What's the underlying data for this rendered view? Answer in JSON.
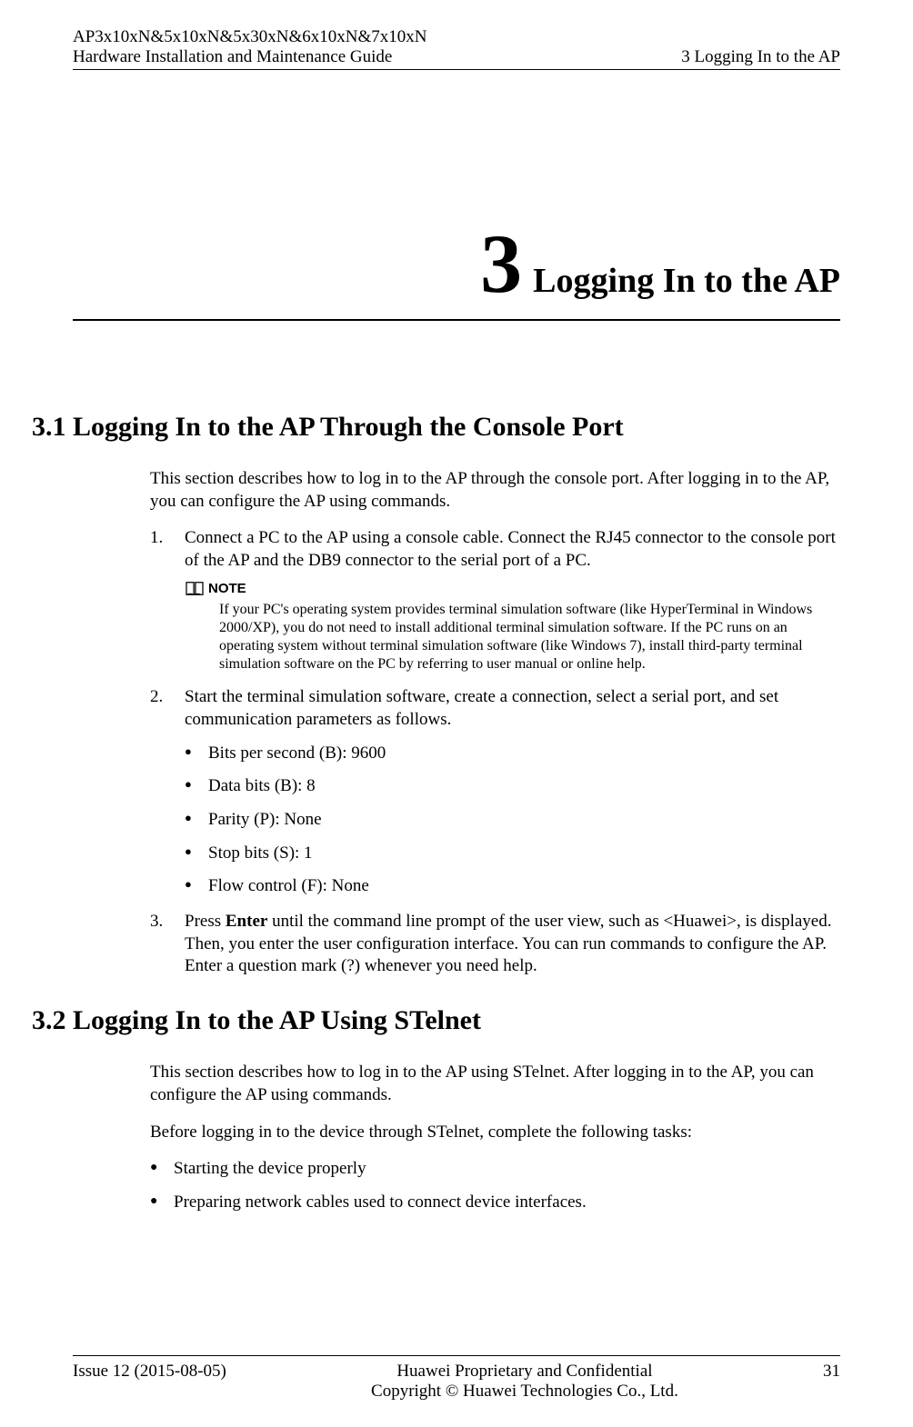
{
  "header": {
    "product_line1": "AP3x10xN&5x10xN&5x30xN&6x10xN&7x10xN",
    "product_line2": "Hardware Installation and Maintenance Guide",
    "right": "3 Logging In to the AP"
  },
  "chapter": {
    "number": "3",
    "title": "Logging In to the AP"
  },
  "section1": {
    "heading": "3.1 Logging In to the AP Through the Console Port",
    "intro": "This section describes how to log in to the AP through the console port. After logging in to the AP, you can configure the AP using commands.",
    "step1_num": "1.",
    "step1": "Connect a PC to the AP using a console cable. Connect the RJ45 connector to the console port of the AP and the DB9 connector to the serial port of a PC.",
    "note_label": "NOTE",
    "note_text": "If your PC's operating system provides terminal simulation software (like HyperTerminal in Windows 2000/XP), you do not need to install additional terminal simulation software. If the PC runs on an operating system without terminal simulation software (like Windows 7), install third-party terminal simulation software on the PC by referring to user manual or online help.",
    "step2_num": "2.",
    "step2": "Start the terminal simulation software, create a connection, select a serial port, and set communication parameters as follows.",
    "params": {
      "bits_per_second": "Bits per second (B): 9600",
      "data_bits": "Data bits (B): 8",
      "parity": "Parity (P): None",
      "stop_bits": "Stop bits (S): 1",
      "flow_control": "Flow control (F): None"
    },
    "step3_num": "3.",
    "step3_pre": "Press ",
    "step3_bold": "Enter",
    "step3_post": " until the command line prompt of the user view, such as <Huawei>, is displayed. Then, you enter the user configuration interface. You can run commands to configure the AP. Enter a question mark (?) whenever you need help."
  },
  "section2": {
    "heading": "3.2 Logging In to the AP Using STelnet",
    "intro": "This section describes how to log in to the AP using STelnet. After logging in to the AP, you can configure the AP using commands.",
    "pretasks": "Before logging in to the device through STelnet, complete the following tasks:",
    "task1": "Starting the device properly",
    "task2": "Preparing network cables used to connect device interfaces."
  },
  "footer": {
    "issue": "Issue 12 (2015-08-05)",
    "center_line1": "Huawei Proprietary and Confidential",
    "center_line2": "Copyright © Huawei Technologies Co., Ltd.",
    "page": "31"
  }
}
